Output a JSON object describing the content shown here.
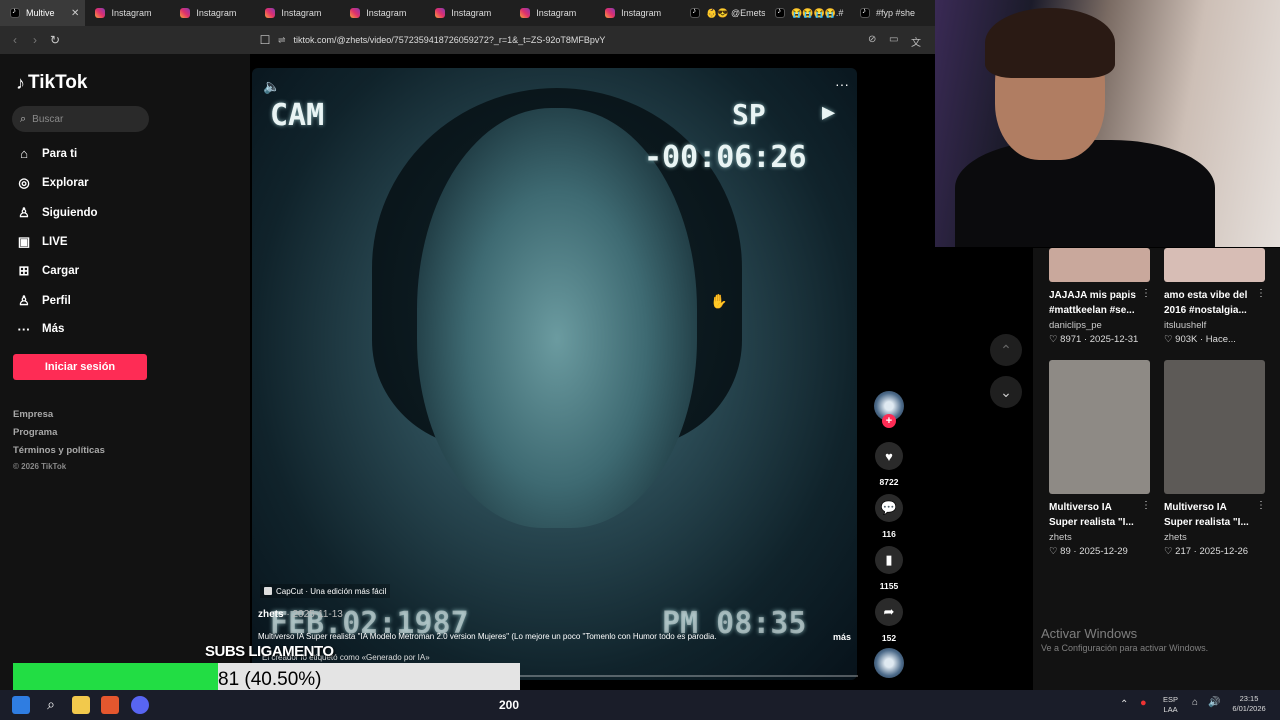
{
  "browser": {
    "tabs": [
      {
        "label": "Multive",
        "favicon": "tiktok",
        "active": true
      },
      {
        "label": "Instagram",
        "favicon": "instagram"
      },
      {
        "label": "Instagram",
        "favicon": "instagram"
      },
      {
        "label": "Instagram",
        "favicon": "instagram"
      },
      {
        "label": "Instagram",
        "favicon": "instagram"
      },
      {
        "label": "Instagram",
        "favicon": "instagram"
      },
      {
        "label": "Instagram",
        "favicon": "instagram"
      },
      {
        "label": "Instagram",
        "favicon": "instagram"
      },
      {
        "label": "👶😎 @Emets",
        "favicon": "tiktok"
      },
      {
        "label": "😭😭😭😭.#",
        "favicon": "tiktok"
      },
      {
        "label": "#fyp #she",
        "favicon": "tiktok"
      }
    ],
    "url": "tiktok.com/@zhets/video/7572359418726059272?_r=1&_t=ZS-92oT8MFBpvY"
  },
  "sidebar": {
    "logo": "TikTok",
    "search_placeholder": "Buscar",
    "nav": [
      {
        "label": "Para ti",
        "icon": "home-icon"
      },
      {
        "label": "Explorar",
        "icon": "compass-icon"
      },
      {
        "label": "Siguiendo",
        "icon": "following-icon"
      },
      {
        "label": "LIVE",
        "icon": "live-icon"
      },
      {
        "label": "Cargar",
        "icon": "upload-icon"
      },
      {
        "label": "Perfil",
        "icon": "profile-icon"
      },
      {
        "label": "Más",
        "icon": "more-icon"
      }
    ],
    "login_button": "Iniciar sesión",
    "footer_links": [
      "Empresa",
      "Programa",
      "Términos y políticas"
    ],
    "copyright": "© 2026 TikTok"
  },
  "video": {
    "overlay": {
      "cam": "CAM",
      "sp": "SP",
      "timecode": "-00:06:26",
      "date": "FEB.02:1987",
      "clock": "PM 08:35"
    },
    "capcut_badge": "CapCut · Una edición más fácil",
    "author": "zhets",
    "date": "· 2025-11-13",
    "caption": "Multiverso IA Super realista \"IA Modelo Metroman 2.0 version Mujeres\" (Lo mejore un poco \"Tomenlo con Humor todo es parodia.",
    "more_label": "más",
    "ai_label": "El creador lo etiquetó como «Generado por IA»"
  },
  "actions": {
    "likes": "8722",
    "comments": "116",
    "saves": "1155",
    "shares": "152"
  },
  "recommended": [
    {
      "title": "JAJAJA mis papis #mattkeelan #se...",
      "author": "daniclips_pe",
      "likes": "8971",
      "date": "2025-12-31",
      "thumb_color": "#c9a89c"
    },
    {
      "title": "amo esta vibe del 2016 #nostalgia...",
      "author": "itsluushelf",
      "likes": "903K",
      "date": "Hace...",
      "thumb_color": "#d7bdb5"
    },
    {
      "title": "Multiverso IA Super realista \"I...",
      "author": "zhets",
      "likes": "89",
      "date": "2025-12-29",
      "thumb_color": "#8e8a85"
    },
    {
      "title": "Multiverso IA Super realista \"I...",
      "author": "zhets",
      "likes": "217",
      "date": "2025-12-26",
      "thumb_color": "#5d5a57"
    }
  ],
  "stream": {
    "subs_title": "SUBS LIGAMENTO",
    "subs_value": "81 (40.50%)",
    "subs_progress": 0.405,
    "taskbar_number": "200",
    "watermark_line1": "Activar Windows",
    "watermark_line2": "Ve a Configuración para activar Windows."
  },
  "system_tray": {
    "lang_top": "ESP",
    "lang_bottom": "LAA",
    "time": "23:15",
    "date": "6/01/2026"
  },
  "colors": {
    "accent": "#fe2c55",
    "progress_green": "#22dd44"
  }
}
